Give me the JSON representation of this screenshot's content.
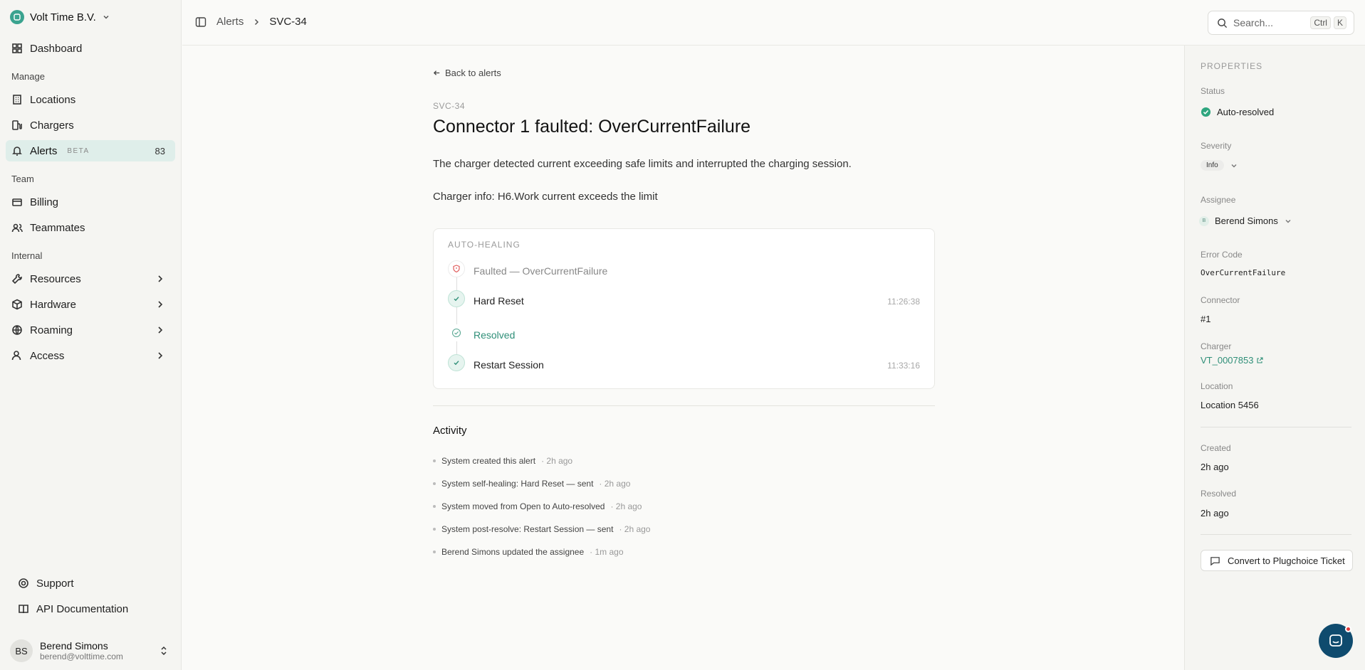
{
  "sidebar": {
    "org_name": "Volt Time B.V.",
    "items": {
      "dashboard": "Dashboard",
      "manage_label": "Manage",
      "locations": "Locations",
      "chargers": "Chargers",
      "alerts": "Alerts",
      "alerts_badge": "BETA",
      "alerts_count": "83",
      "team_label": "Team",
      "billing": "Billing",
      "teammates": "Teammates",
      "internal_label": "Internal",
      "resources": "Resources",
      "hardware": "Hardware",
      "roaming": "Roaming",
      "access": "Access",
      "support": "Support",
      "api_docs": "API Documentation"
    },
    "user": {
      "initials": "BS",
      "name": "Berend Simons",
      "email": "berend@volttime.com"
    }
  },
  "topbar": {
    "breadcrumb_parent": "Alerts",
    "breadcrumb_current": "SVC-34",
    "search_placeholder": "Search...",
    "shortcut_1": "Ctrl",
    "shortcut_2": "K"
  },
  "alert": {
    "back_label": "Back to alerts",
    "id": "SVC-34",
    "title": "Connector 1 faulted: OverCurrentFailure",
    "description": "The charger detected current exceeding safe limits and interrupted the charging session.",
    "charger_info": "Charger info: H6.Work current exceeds the limit"
  },
  "auto_healing": {
    "title": "AUTO-HEALING",
    "steps": [
      {
        "label": "Faulted — OverCurrentFailure",
        "time": ""
      },
      {
        "label": "Hard Reset",
        "time": "11:26:38"
      },
      {
        "label": "Resolved",
        "time": ""
      },
      {
        "label": "Restart Session",
        "time": "11:33:16"
      }
    ]
  },
  "activity": {
    "title": "Activity",
    "items": [
      {
        "text": "System created this alert",
        "time": "· 2h ago"
      },
      {
        "text": "System self-healing: Hard Reset — sent",
        "time": "· 2h ago"
      },
      {
        "text": "System moved from Open to Auto-resolved",
        "time": "· 2h ago"
      },
      {
        "text": "System post-resolve: Restart Session — sent",
        "time": "· 2h ago"
      },
      {
        "text": "Berend Simons updated the assignee",
        "time": "· 1m ago"
      }
    ]
  },
  "properties": {
    "heading": "PROPERTIES",
    "status_label": "Status",
    "status_value": "Auto-resolved",
    "severity_label": "Severity",
    "severity_value": "Info",
    "assignee_label": "Assignee",
    "assignee_initial": "B",
    "assignee_value": "Berend Simons",
    "error_code_label": "Error Code",
    "error_code_value": "OverCurrentFailure",
    "connector_label": "Connector",
    "connector_value": "#1",
    "charger_label": "Charger",
    "charger_value": "VT_0007853",
    "location_label": "Location",
    "location_value": "Location 5456",
    "created_label": "Created",
    "created_value": "2h ago",
    "resolved_label": "Resolved",
    "resolved_value": "2h ago",
    "convert_label": "Convert to Plugchoice Ticket"
  },
  "colors": {
    "accent": "#2f8f78",
    "active_bg": "#dfeeea",
    "danger": "#e05a5a"
  }
}
